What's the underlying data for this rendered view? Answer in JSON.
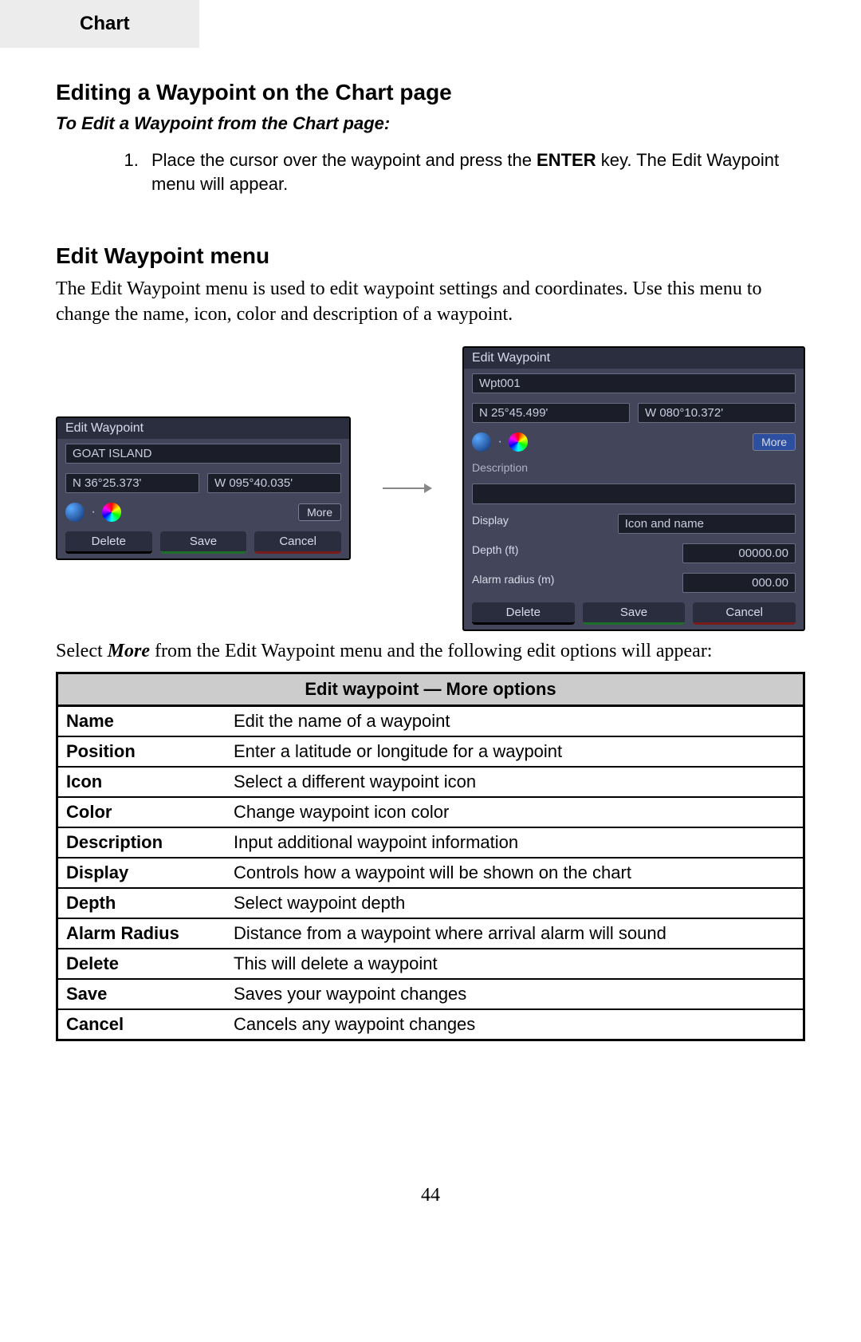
{
  "header": {
    "tab": "Chart"
  },
  "section1": {
    "title": "Editing a Waypoint on the Chart page",
    "subtitle": "To Edit a Waypoint from the Chart page:",
    "step_pre": "Place the cursor over the waypoint and press the ",
    "step_key": "ENTER",
    "step_post": " key. The Edit Waypoint menu will appear."
  },
  "section2": {
    "title": "Edit Waypoint menu",
    "intro": "The Edit Waypoint menu is used to edit waypoint settings and coordinates. Use this menu to change the name, icon, color and description of a waypoint."
  },
  "panelA": {
    "title": "Edit Waypoint",
    "name": "GOAT ISLAND",
    "lat": "N 36°25.373'",
    "lon": "W 095°40.035'",
    "more": "More",
    "btn_delete": "Delete",
    "btn_save": "Save",
    "btn_cancel": "Cancel"
  },
  "panelB": {
    "title": "Edit Waypoint",
    "name": "Wpt001",
    "lat": "N 25°45.499'",
    "lon": "W 080°10.372'",
    "more": "More",
    "desc_label": "Description",
    "display_label": "Display",
    "display_val": "Icon and name",
    "depth_label": "Depth (ft)",
    "depth_val": "00000.00",
    "alarm_label": "Alarm radius (m)",
    "alarm_val": "000.00",
    "btn_delete": "Delete",
    "btn_save": "Save",
    "btn_cancel": "Cancel"
  },
  "after_shots_pre": "Select ",
  "after_shots_key": "More",
  "after_shots_post": " from the Edit Waypoint menu and the following edit options will appear:",
  "table": {
    "header": "Edit waypoint — More options",
    "rows": [
      {
        "k": "Name",
        "v": "Edit the name of a waypoint"
      },
      {
        "k": "Position",
        "v": "Enter a latitude or longitude for a waypoint"
      },
      {
        "k": "Icon",
        "v": "Select a different waypoint icon"
      },
      {
        "k": "Color",
        "v": "Change waypoint icon color"
      },
      {
        "k": "Description",
        "v": "Input additional waypoint information"
      },
      {
        "k": "Display",
        "v": "Controls how a waypoint will be shown on  the chart"
      },
      {
        "k": "Depth",
        "v": "Select waypoint depth"
      },
      {
        "k": "Alarm Radius",
        "v": "Distance from a waypoint where arrival alarm will sound"
      },
      {
        "k": "Delete",
        "v": "This will delete a waypoint"
      },
      {
        "k": "Save",
        "v": "Saves your waypoint changes"
      },
      {
        "k": "Cancel",
        "v": "Cancels any waypoint changes"
      }
    ]
  },
  "page_number": "44"
}
